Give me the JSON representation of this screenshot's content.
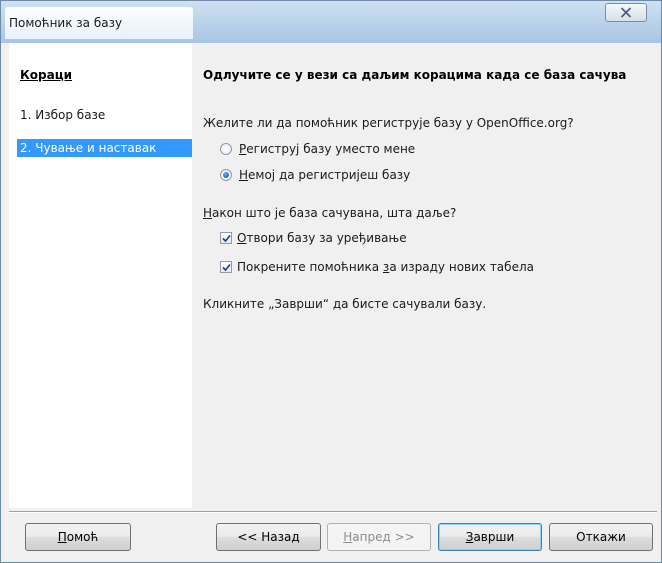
{
  "window": {
    "title": "Помоћник за базу"
  },
  "steps": {
    "title": "Кораци",
    "items": [
      {
        "label": "1. Избор базе",
        "active": false
      },
      {
        "label": "2. Чување и наставак",
        "active": true
      }
    ]
  },
  "main": {
    "title": "Одлучите се у вези са даљим корацима када се база сачува",
    "register_question": "Желите ли да помоћник региструје базу у OpenOffice.org?",
    "register_options": [
      {
        "mnemonic": "Р",
        "rest": "егиструј базу уместо мене",
        "selected": false
      },
      {
        "mnemonic": "Н",
        "rest": "емој да регистријеш базу",
        "selected": true
      }
    ],
    "after_save": {
      "mnemonic": "Н",
      "rest": "акон што је база сачувана, шта даље?"
    },
    "after_options": [
      {
        "mnemonic": "О",
        "rest": "твори базу за уређивање",
        "checked": true
      },
      {
        "before": "Покрените помоћника ",
        "mnemonic": "з",
        "rest": "а израду нових табела",
        "checked": true
      }
    ],
    "finish_hint": "Кликните „Заврши“ да бисте сачували базу."
  },
  "buttons": {
    "help": {
      "mnemonic": "П",
      "rest": "омоћ"
    },
    "back": {
      "before": "<< Наза",
      "mnemonic": "д"
    },
    "next": {
      "mnemonic": "Н",
      "rest": "апред >>"
    },
    "finish": {
      "mnemonic": "З",
      "rest": "аврши"
    },
    "cancel": "Откажи"
  },
  "colors": {
    "selection": "#3399ff",
    "dialog_bg": "#f0f0f0",
    "title_bar": "#b9d1ea"
  }
}
